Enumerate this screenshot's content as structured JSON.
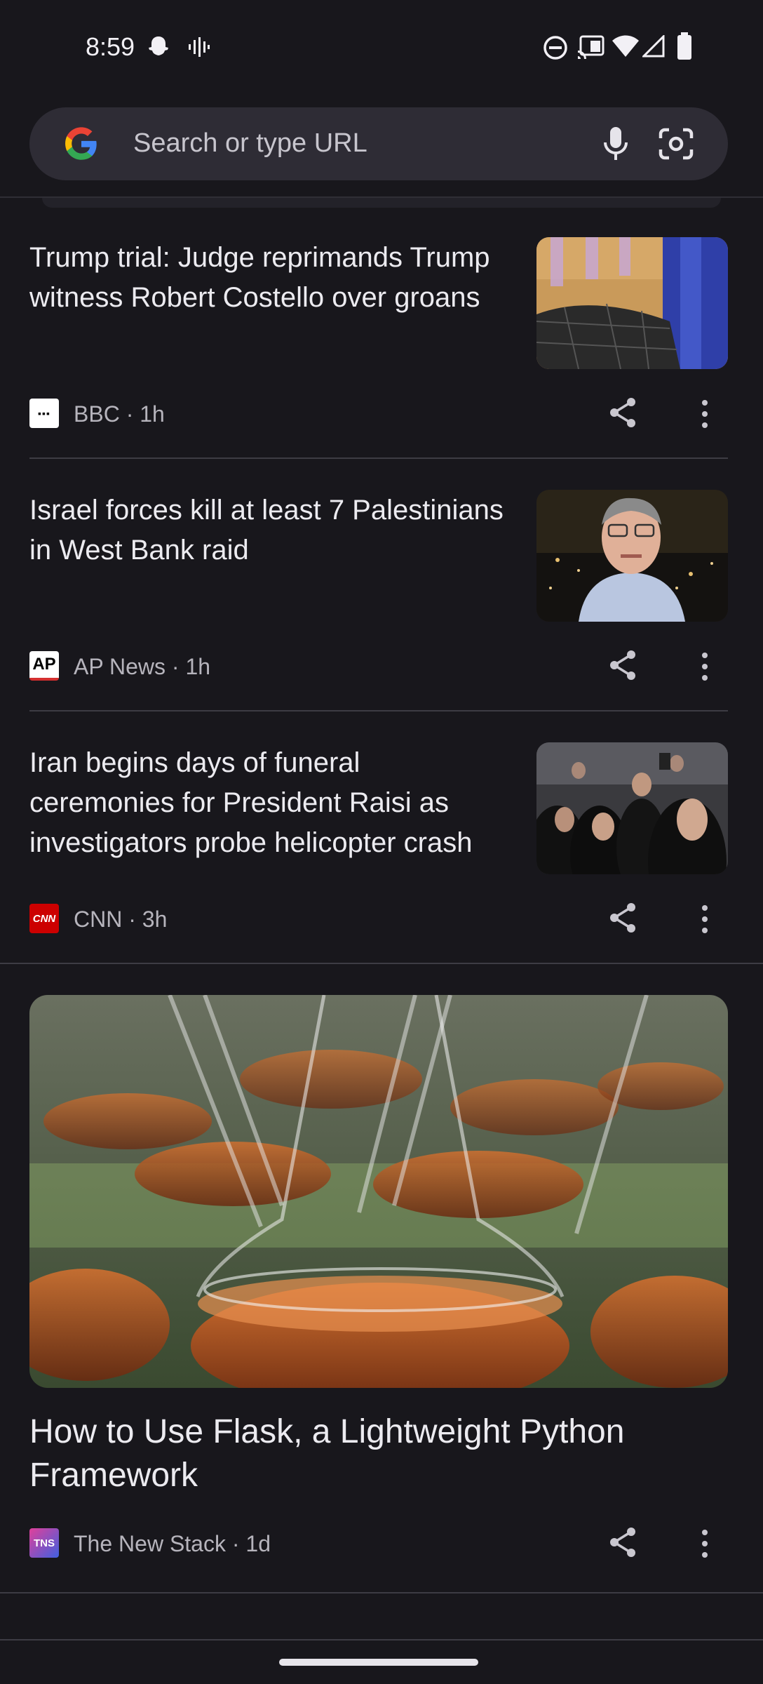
{
  "status_bar": {
    "time": "8:59",
    "icons": [
      "snapchat-icon",
      "sound-wave-icon",
      "dnd-icon",
      "cast-icon",
      "wifi-icon",
      "signal-icon",
      "battery-icon"
    ]
  },
  "search": {
    "placeholder": "Search or type URL",
    "icons": [
      "google-logo",
      "mic-icon",
      "lens-icon"
    ]
  },
  "articles": [
    {
      "title": "Trump trial: Judge reprimands Trump witness Robert Costello over groans",
      "source": "BBC · 1h",
      "logo_text": "▪▪▪"
    },
    {
      "title": "Israel forces kill at least 7 Palestinians in West Bank raid",
      "source": "AP News · 1h",
      "logo_text": "AP"
    },
    {
      "title": "Iran begins days of funeral ceremonies for President Raisi as investigators probe helicopter crash",
      "source": "CNN · 3h",
      "logo_text": "CNN"
    }
  ],
  "featured": {
    "title": "How to Use Flask, a Lightweight Python Framework",
    "source": "The New Stack · 1d",
    "logo_text": "TNS"
  },
  "colors": {
    "background": "#18171c",
    "search_bg": "#2e2c35",
    "divider": "#3d3c44",
    "cnn_red": "#cc0000"
  }
}
